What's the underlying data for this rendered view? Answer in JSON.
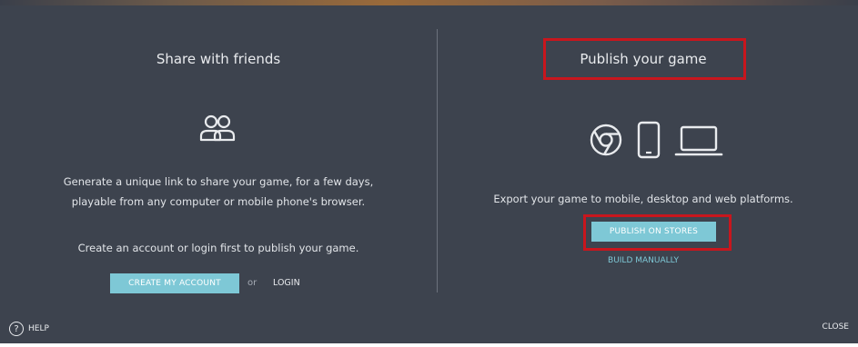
{
  "dialog": {
    "left_panel": {
      "title": "Share with friends",
      "icon": "people-icon",
      "description_line1": "Generate a unique link to share your game, for a few days,",
      "description_line2": "playable from any computer or mobile phone's browser.",
      "login_note": "Create an account or login first to publish your game.",
      "create_account_label": "CREATE MY ACCOUNT",
      "or_label": "or",
      "login_label": "LOGIN"
    },
    "right_panel": {
      "title": "Publish your game",
      "icons": [
        "chrome-icon",
        "phone-icon",
        "laptop-icon"
      ],
      "description": "Export your game to mobile, desktop and web platforms.",
      "publish_button_label": "PUBLISH ON STORES",
      "build_manually_label": "BUILD MANUALLY"
    },
    "footer": {
      "help_label": "HELP",
      "help_icon_glyph": "?",
      "close_label": "CLOSE"
    }
  },
  "colors": {
    "dialog_background": "#3d434e",
    "accent_teal": "#7ec8d6",
    "highlight_red": "#c8161d",
    "text": "#e9ebee"
  }
}
